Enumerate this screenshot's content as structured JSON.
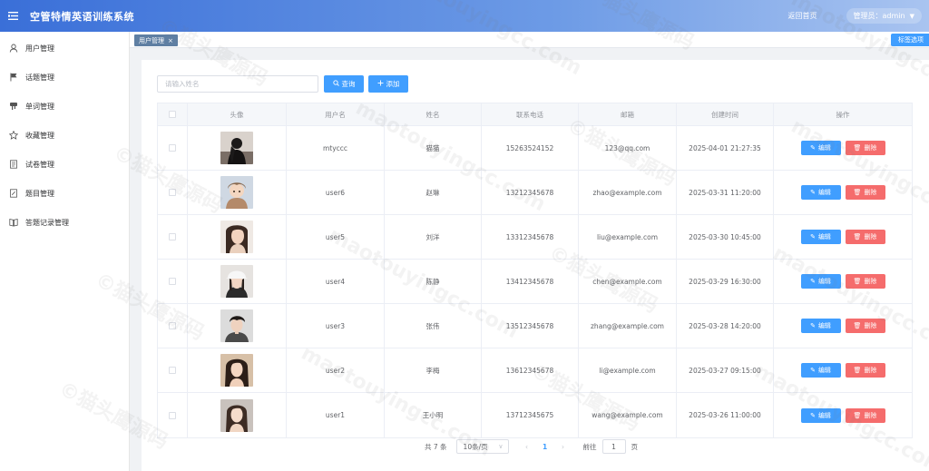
{
  "header": {
    "title": "空管特情英语训练系统",
    "home_link": "返回首页",
    "admin_label": "管理员：admin"
  },
  "sidebar": {
    "items": [
      {
        "label": "用户管理",
        "icon": "user-icon"
      },
      {
        "label": "话题管理",
        "icon": "flag-icon"
      },
      {
        "label": "单词管理",
        "icon": "hand-icon"
      },
      {
        "label": "收藏管理",
        "icon": "star-icon"
      },
      {
        "label": "试卷管理",
        "icon": "document-icon"
      },
      {
        "label": "题目管理",
        "icon": "edit-doc-icon"
      },
      {
        "label": "答题记录管理",
        "icon": "book-icon"
      }
    ]
  },
  "tabs": {
    "active_tab": "用户管理",
    "options_label": "标签选项"
  },
  "search": {
    "placeholder": "请输入姓名",
    "search_label": "查询",
    "add_label": "添加"
  },
  "table": {
    "headers": [
      "",
      "头像",
      "用户名",
      "姓名",
      "联系电话",
      "邮箱",
      "创建时间",
      "操作"
    ],
    "edit_label": "编辑",
    "delete_label": "删除",
    "rows": [
      {
        "username": "mtyccc",
        "name": "猫猫",
        "phone": "15263524152",
        "email": "123@qq.com",
        "created": "2025-04-01 21:27:35",
        "avatar": "dark-silhouette"
      },
      {
        "username": "user6",
        "name": "赵琳",
        "phone": "13212345678",
        "email": "zhao@example.com",
        "created": "2025-03-31 11:20:00",
        "avatar": "anime-boy"
      },
      {
        "username": "user5",
        "name": "刘洋",
        "phone": "13312345678",
        "email": "liu@example.com",
        "created": "2025-03-30 10:45:00",
        "avatar": "girl-portrait"
      },
      {
        "username": "user4",
        "name": "陈静",
        "phone": "13412345678",
        "email": "chen@example.com",
        "created": "2025-03-29 16:30:00",
        "avatar": "girl-white-cap"
      },
      {
        "username": "user3",
        "name": "张伟",
        "phone": "13512345678",
        "email": "zhang@example.com",
        "created": "2025-03-28 14:20:00",
        "avatar": "boy-portrait"
      },
      {
        "username": "user2",
        "name": "李梅",
        "phone": "13612345678",
        "email": "li@example.com",
        "created": "2025-03-27 09:15:00",
        "avatar": "girl-long-hair"
      },
      {
        "username": "user1",
        "name": "王小明",
        "phone": "13712345675",
        "email": "wang@example.com",
        "created": "2025-03-26 11:00:00",
        "avatar": "girl-light"
      }
    ]
  },
  "pagination": {
    "total": "共 7 条",
    "page_size": "10条/页",
    "current_page": "1",
    "goto_label": "前往",
    "goto_value": "1",
    "page_unit": "页"
  },
  "watermark": {
    "text_cn": "©猫头鹰源码",
    "text_en": "maotouyingcc.com"
  },
  "colors": {
    "primary": "#409eff",
    "danger": "#f56c6c",
    "header_gradient_start": "#3a6fd8",
    "tab_active": "#5f7fa3"
  }
}
